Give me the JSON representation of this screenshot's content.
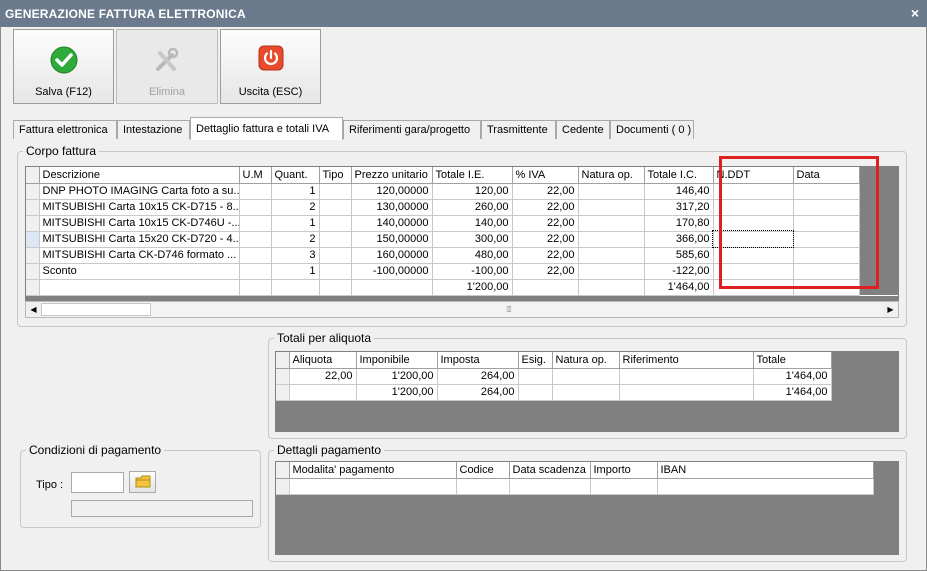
{
  "window": {
    "title": "GENERAZIONE FATTURA ELETTRONICA",
    "close_glyph": "×"
  },
  "toolbar": {
    "save": {
      "label": "Salva (F12)",
      "icon": "check-circle-icon",
      "color": "#2eaa3a"
    },
    "delete": {
      "label": "Elimina",
      "icon": "tools-icon"
    },
    "exit": {
      "label": "Uscita (ESC)",
      "icon": "power-icon",
      "color": "#e84a2b"
    }
  },
  "tabs": [
    "Fattura elettronica",
    "Intestazione",
    "Dettaglio fattura e totali IVA",
    "Riferimenti gara/progetto",
    "Trasmittente",
    "Cedente",
    "Documenti ( 0 )"
  ],
  "corpo": {
    "legend": "Corpo fattura",
    "columns": [
      "Descrizione",
      "U.M",
      "Quant.",
      "Tipo",
      "Prezzo unitario",
      "Totale I.E.",
      "% IVA",
      "Natura op.",
      "Totale I.C.",
      "N.DDT",
      "Data"
    ],
    "rows": [
      [
        "DNP PHOTO IMAGING Carta foto a su...",
        "",
        "1",
        "",
        "120,00000",
        "120,00",
        "22,00",
        "",
        "146,40",
        "",
        ""
      ],
      [
        "MITSUBISHI Carta 10x15 CK-D715 - 8...",
        "",
        "2",
        "",
        "130,00000",
        "260,00",
        "22,00",
        "",
        "317,20",
        "",
        ""
      ],
      [
        "MITSUBISHI Carta 10x15 CK-D746U -...",
        "",
        "1",
        "",
        "140,00000",
        "140,00",
        "22,00",
        "",
        "170,80",
        "",
        ""
      ],
      [
        "MITSUBISHI Carta 15x20 CK-D720 - 4...",
        "",
        "2",
        "",
        "150,00000",
        "300,00",
        "22,00",
        "",
        "366,00",
        "",
        ""
      ],
      [
        "MITSUBISHI Carta CK-D746 formato ...",
        "",
        "3",
        "",
        "160,00000",
        "480,00",
        "22,00",
        "",
        "585,60",
        "",
        ""
      ],
      [
        "Sconto",
        "",
        "1",
        "",
        "-100,00000",
        "-100,00",
        "22,00",
        "",
        "-122,00",
        "",
        ""
      ]
    ],
    "total_row": [
      "",
      "",
      "",
      "",
      "",
      "1'200,00",
      "",
      "",
      "1'464,00",
      "",
      ""
    ]
  },
  "totali": {
    "legend": "Totali per aliquota",
    "columns": [
      "Aliquota",
      "Imponibile",
      "Imposta",
      "Esig.",
      "Natura op.",
      "Riferimento",
      "Totale"
    ],
    "rows": [
      [
        "22,00",
        "1'200,00",
        "264,00",
        "",
        "",
        "",
        "1'464,00"
      ],
      [
        "",
        "1'200,00",
        "264,00",
        "",
        "",
        "",
        "1'464,00"
      ]
    ]
  },
  "condizioni": {
    "legend": "Condizioni di pagamento",
    "tipo_label": "Tipo :",
    "tipo_value": "",
    "folder_icon": "folder-icon"
  },
  "dettagli": {
    "legend": "Dettagli pagamento",
    "columns": [
      "Modalita' pagamento",
      "Codice",
      "Data scadenza",
      "Importo",
      "IBAN"
    ]
  },
  "colors": {
    "highlight": "#e02020",
    "grid_bg": "#808080"
  }
}
